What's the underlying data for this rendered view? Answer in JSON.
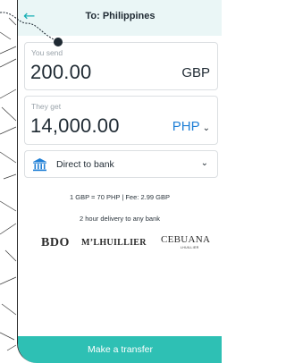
{
  "header": {
    "title": "To: Philippines",
    "back_icon": "back-arrow-icon"
  },
  "send": {
    "label": "You send",
    "amount": "200.00",
    "currency": "GBP"
  },
  "receive": {
    "label": "They get",
    "amount": "14,000.00",
    "currency": "PHP"
  },
  "method": {
    "label": "Direct to bank",
    "icon": "bank-icon"
  },
  "info": {
    "rate": "1 GBP = 70 PHP  |  Fee: 2.99 GBP",
    "delivery": "2 hour delivery to any bank"
  },
  "banks": {
    "bdo": "BDO",
    "mlhuillier": "M’LHUILLIER",
    "cebuana": "CEBUANA",
    "cebuana_sub": "LHUILLIER"
  },
  "cta": {
    "label": "Make a transfer"
  },
  "colors": {
    "accent": "#19b0b5",
    "cta": "#2ec0b4",
    "currency_link": "#1f7fd6",
    "header_bg": "#eaf6f6"
  }
}
